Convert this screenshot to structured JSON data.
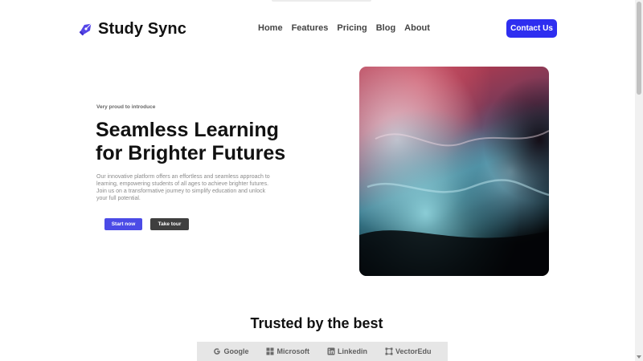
{
  "header": {
    "brand_name": "Study Sync",
    "nav": [
      {
        "label": "Home"
      },
      {
        "label": "Features"
      },
      {
        "label": "Pricing"
      },
      {
        "label": "Blog"
      },
      {
        "label": "About"
      }
    ],
    "contact_label": "Contact Us"
  },
  "hero": {
    "eyebrow": "Very proud to introduce",
    "title": "Seamless Learning for Brighter Futures",
    "description": "Our innovative platform offers an effortless and seamless approach to learning, empowering students of all ages to achieve brighter futures. Join us on a transformative journey to simplify education and unlock your full potential.",
    "primary_button": "Start now",
    "secondary_button": "Take tour"
  },
  "trusted": {
    "title": "Trusted by the best",
    "brands": [
      {
        "name": "Google",
        "icon": "google-icon"
      },
      {
        "name": "Microsoft",
        "icon": "microsoft-icon"
      },
      {
        "name": "Linkedin",
        "icon": "linkedin-icon"
      },
      {
        "name": "VectorEdu",
        "icon": "vector-icon"
      }
    ]
  },
  "colors": {
    "accent": "#2e2ef0",
    "primary_button": "#4b4be6",
    "secondary_button": "#3f3f3f",
    "logo_bar": "#e6e6e6"
  }
}
